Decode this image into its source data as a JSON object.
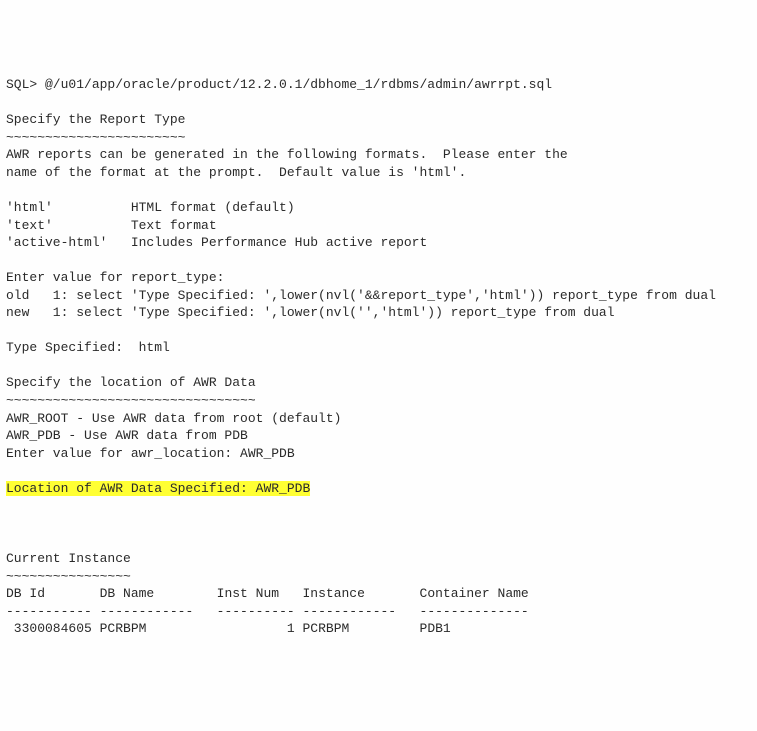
{
  "sql_prompt": "SQL> @/u01/app/oracle/product/12.2.0.1/dbhome_1/rdbms/admin/awrrpt.sql",
  "report_type_header": "Specify the Report Type",
  "report_type_tilde": "~~~~~~~~~~~~~~~~~~~~~~~",
  "intro_line1": "AWR reports can be generated in the following formats.  Please enter the",
  "intro_line2": "name of the format at the prompt.  Default value is 'html'.",
  "fmt_html": "'html'          HTML format (default)",
  "fmt_text": "'text'          Text format",
  "fmt_active": "'active-html'   Includes Performance Hub active report",
  "enter_report_type": "Enter value for report_type:",
  "old_line": "old   1: select 'Type Specified: ',lower(nvl('&&report_type','html')) report_type from dual",
  "new_line": "new   1: select 'Type Specified: ',lower(nvl('','html')) report_type from dual",
  "type_specified": "Type Specified:  html",
  "awr_loc_header": "Specify the location of AWR Data",
  "awr_loc_tilde": "~~~~~~~~~~~~~~~~~~~~~~~~~~~~~~~~",
  "awr_root": "AWR_ROOT - Use AWR data from root (default)",
  "awr_pdb": "AWR_PDB - Use AWR data from PDB",
  "enter_awr_loc": "Enter value for awr_location: AWR_PDB",
  "loc_specified": "Location of AWR Data Specified: AWR_PDB",
  "current_instance_header": "Current Instance",
  "current_instance_tilde": "~~~~~~~~~~~~~~~~",
  "table": {
    "h_dbid": "DB Id       ",
    "h_dbname": "DB Name        ",
    "h_instnum": "Inst Num   ",
    "h_instance": "Instance       ",
    "h_cont": "Container Name",
    "u_dbid": "----------- ",
    "u_dbname": "------------   ",
    "u_instnum": "---------- ",
    "u_instance": "------------   ",
    "u_cont": "--------------",
    "v_dbid": " 3300084605 ",
    "v_dbname": "PCRBPM         ",
    "v_instnum": "         1 ",
    "v_instance": "PCRBPM         ",
    "v_cont": "PDB1"
  }
}
